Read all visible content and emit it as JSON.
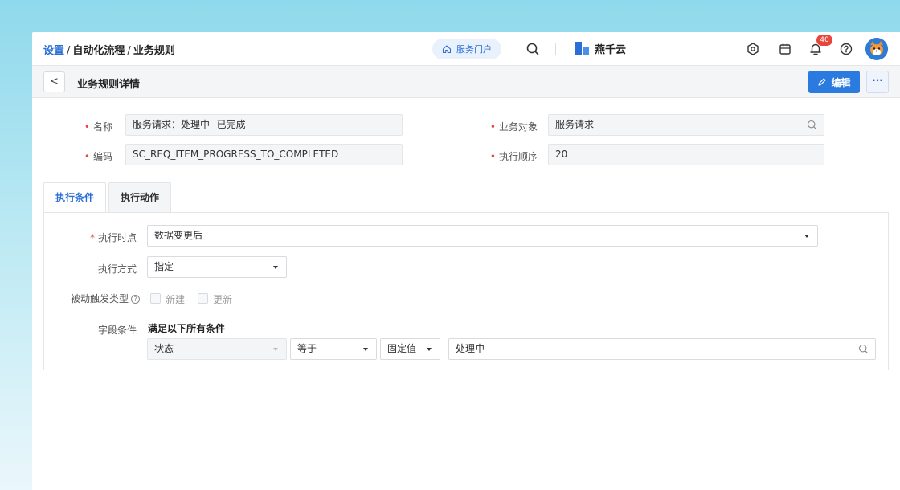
{
  "breadcrumb": {
    "part1": "设置",
    "separator": "/",
    "part2": "自动化流程",
    "part3": "业务规则"
  },
  "topbar": {
    "portal_label": "服务门户",
    "brand_name": "燕千云",
    "notification_count": "40"
  },
  "header": {
    "back_glyph": "<",
    "title": "业务规则详情",
    "edit_label": "编辑",
    "more_glyph": "···"
  },
  "form": {
    "name_label": "名称",
    "name_value": "服务请求：处理中--已完成",
    "code_label": "编码",
    "code_value": "SC_REQ_ITEM_PROGRESS_TO_COMPLETED",
    "object_label": "业务对象",
    "object_value": "服务请求",
    "order_label": "执行顺序",
    "order_value": "20",
    "required_mark": "•"
  },
  "tabs": [
    {
      "label": "执行条件",
      "active": true
    },
    {
      "label": "执行动作",
      "active": false
    }
  ],
  "conditions": {
    "required_mark": "*",
    "timing_label": "执行时点",
    "timing_value": "数据变更后",
    "mode_label": "执行方式",
    "mode_value": "指定",
    "trigger_label": "被动触发类型",
    "trigger_options": [
      "新建",
      "更新"
    ],
    "field_cond_label": "字段条件",
    "field_cond_summary": "满足以下所有条件",
    "cond_field": "状态",
    "cond_operator": "等于",
    "cond_value_type": "固定值",
    "cond_value": "处理中"
  },
  "colors": {
    "accent": "#2b7ae0",
    "required": "#e8453c",
    "badge": "#e8453c"
  },
  "icons": [
    "home-icon",
    "search-icon",
    "settings-icon",
    "calendar-icon",
    "bell-icon",
    "help-icon",
    "pencil-icon"
  ]
}
